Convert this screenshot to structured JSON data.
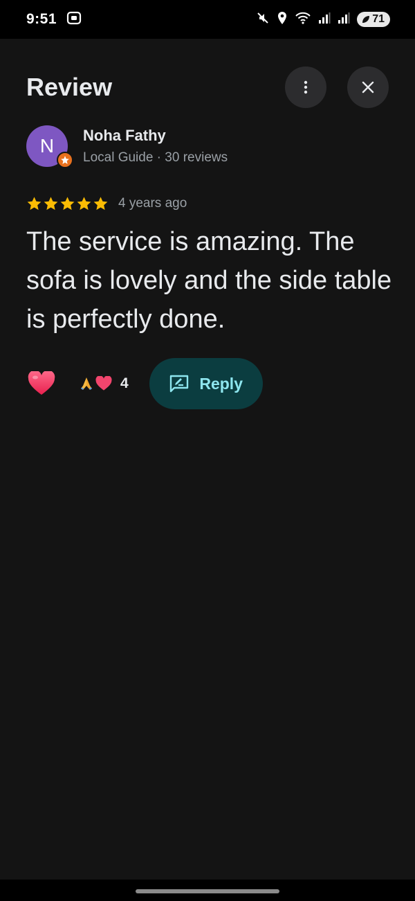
{
  "status_bar": {
    "time": "9:51",
    "battery": "71"
  },
  "header": {
    "title": "Review"
  },
  "author": {
    "initial": "N",
    "name": "Noha Fathy",
    "meta": "Local Guide · 30 reviews"
  },
  "review": {
    "rating": 5,
    "max_rating": 5,
    "time_ago": "4 years ago",
    "text": "The service is amazing. The sofa is lovely and the side table is perfectly done."
  },
  "reactions": {
    "count": "4",
    "emojis": [
      "pray-emoji",
      "heart-emoji"
    ]
  },
  "reply": {
    "label": "Reply"
  },
  "colors": {
    "background": "#141414",
    "avatar": "#7e57c2",
    "star": "#fbbc04",
    "reply_bg": "#0b3d40",
    "reply_text": "#8ee6ef",
    "heart": "#f2456d"
  }
}
